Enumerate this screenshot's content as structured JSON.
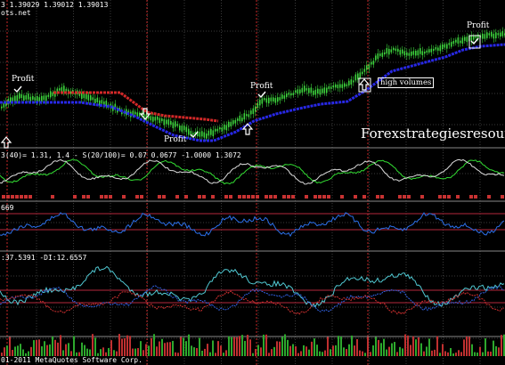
{
  "header": {
    "price_line": "3 1.39029 1.39012 1.39013",
    "site_fragment": "ots.net"
  },
  "main": {
    "profit_labels": [
      "Profit",
      "Profit",
      "Profit",
      "Profit"
    ],
    "high_volumes": "high volumes",
    "watermark": "Forexstrategiesresour"
  },
  "panels": {
    "indicator1_header": "3(40)= 1.31, 1.4 - S(20/100)= 0.07  0.0677 -1.0000 1.3072",
    "indicator2_header": "669",
    "indicator3_header": ":37.5391 -DI:12.6557",
    "footer": "01-2011 MetaQuotes Software Corp."
  },
  "colors": {
    "background": "#000000",
    "candles": "#3cd23c",
    "resistance": "#d22828",
    "support": "#2828e6",
    "osc_green": "#32dc32",
    "osc_white": "#dcdcdc",
    "rsi_line": "#2b6fe8",
    "level_line": "#b4283c",
    "adx_cyan": "#50c8d2",
    "vertical_marker": "#c82828"
  },
  "icons": [
    "arrow-down-icon",
    "arrow-up-icon",
    "checkmark-icon"
  ]
}
